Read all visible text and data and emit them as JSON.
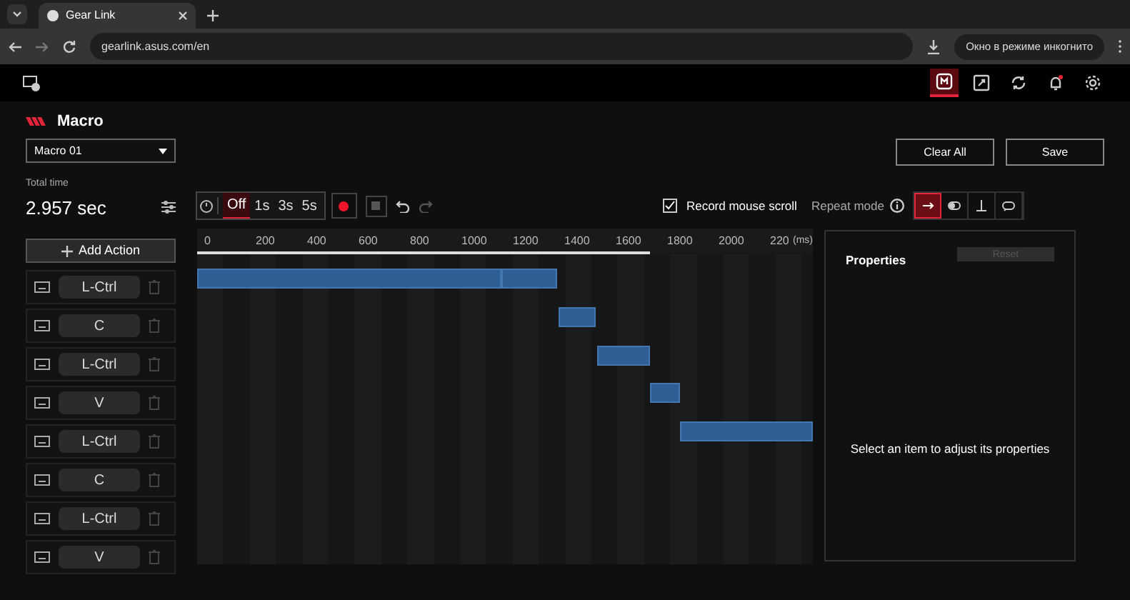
{
  "browser": {
    "tab_title": "Gear Link",
    "url": "gearlink.asus.com/en",
    "incognito_label": "Окно в режиме инкогнито"
  },
  "app_nav": [
    {
      "kind": "macro",
      "selected": true
    },
    {
      "kind": "edit",
      "selected": false
    },
    {
      "kind": "sync",
      "selected": false
    },
    {
      "kind": "bell",
      "selected": false
    },
    {
      "kind": "gear",
      "selected": false
    }
  ],
  "title": "Macro",
  "macro_select": {
    "value": "Macro 01"
  },
  "buttons": [
    "Clear All",
    "Save"
  ],
  "total_time": {
    "label": "Total time",
    "value": "2.957 sec"
  },
  "delay_options": [
    {
      "label": "Off",
      "selected": true
    },
    {
      "label": "1s",
      "selected": false
    },
    {
      "label": "3s",
      "selected": false
    },
    {
      "label": "5s",
      "selected": false
    }
  ],
  "record_mouse_scroll": {
    "label": "Record mouse scroll",
    "checked": true
  },
  "repeat_mode": {
    "label": "Repeat mode",
    "options": [
      {
        "kind": "once",
        "selected": true
      },
      {
        "kind": "toggle",
        "selected": false
      },
      {
        "kind": "hold",
        "selected": false
      },
      {
        "kind": "loop",
        "selected": false
      }
    ]
  },
  "add_action": "Add Action",
  "actions": [
    {
      "key": "L-Ctrl"
    },
    {
      "key": "C"
    },
    {
      "key": "L-Ctrl"
    },
    {
      "key": "V"
    },
    {
      "key": "L-Ctrl"
    },
    {
      "key": "C"
    },
    {
      "key": "L-Ctrl"
    },
    {
      "key": "V"
    }
  ],
  "timeline": {
    "ticks": [
      "0",
      "200",
      "400",
      "600",
      "800",
      "1000",
      "1200",
      "1400",
      "1600",
      "1800",
      "2000",
      "220"
    ],
    "unit": "(ms)"
  },
  "properties": {
    "title": "Properties",
    "reset": "Reset",
    "hint": "Select an item to adjust its properties"
  }
}
